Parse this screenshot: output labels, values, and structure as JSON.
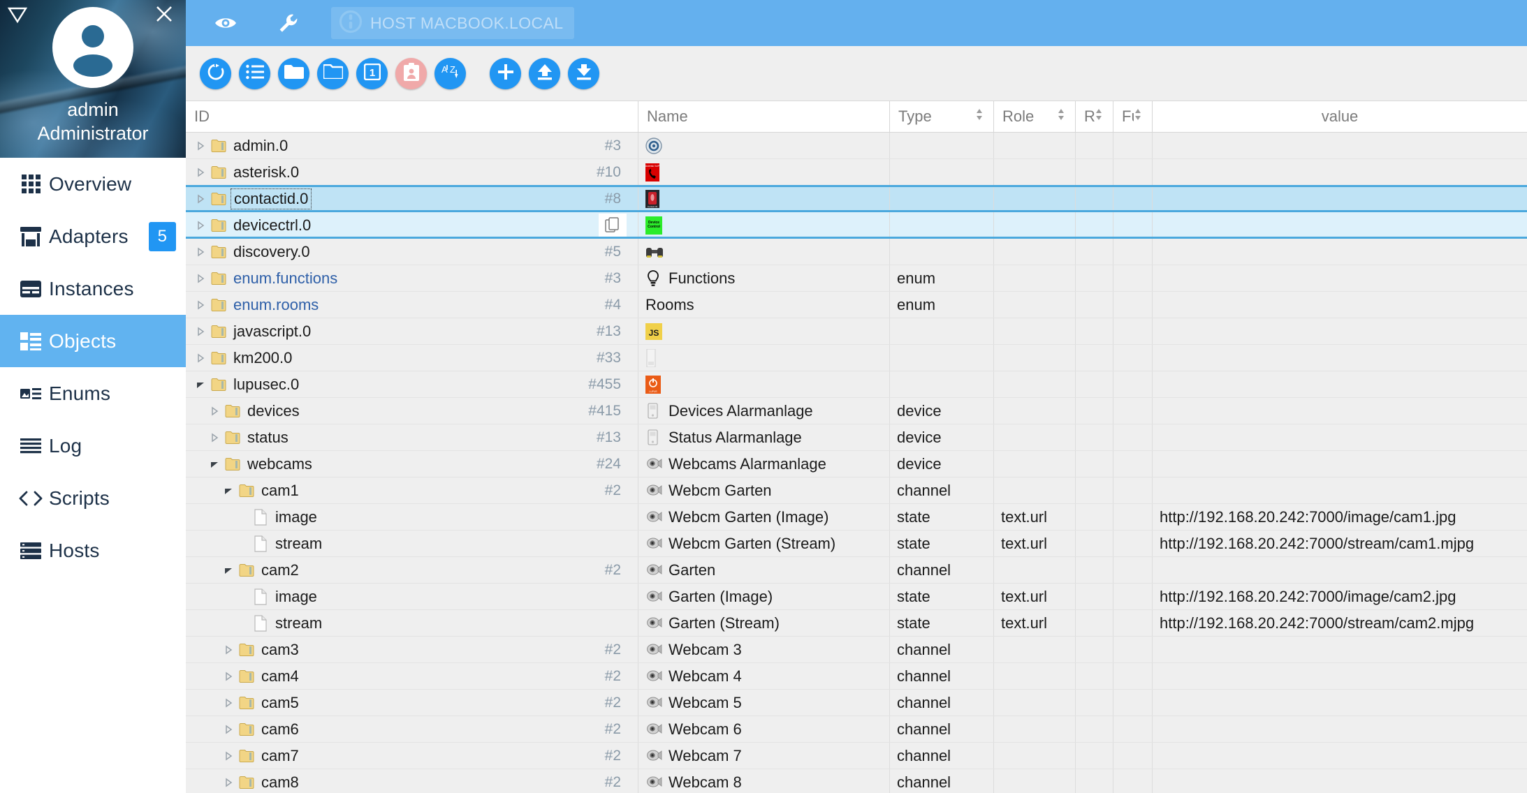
{
  "sidebar": {
    "caret_icon": "triangle-down-icon",
    "close_icon": "close-icon",
    "avatar_icon": "user-avatar-icon",
    "user_name": "admin",
    "user_role": "Administrator",
    "items": [
      {
        "label": "Overview",
        "icon": "grid-icon",
        "active": false,
        "badge": ""
      },
      {
        "label": "Adapters",
        "icon": "store-icon",
        "active": false,
        "badge": "5"
      },
      {
        "label": "Instances",
        "icon": "instances-icon",
        "active": false,
        "badge": ""
      },
      {
        "label": "Objects",
        "icon": "list-box-icon",
        "active": true,
        "badge": ""
      },
      {
        "label": "Enums",
        "icon": "enums-icon",
        "active": false,
        "badge": ""
      },
      {
        "label": "Log",
        "icon": "lines-icon",
        "active": false,
        "badge": ""
      },
      {
        "label": "Scripts",
        "icon": "code-icon",
        "active": false,
        "badge": ""
      },
      {
        "label": "Hosts",
        "icon": "server-icon",
        "active": false,
        "badge": ""
      }
    ]
  },
  "topbar": {
    "eye_icon": "eye-icon",
    "wrench_icon": "wrench-icon",
    "host_icon": "power-info-icon",
    "host_label": "HOST MACBOOK.LOCAL",
    "accent_color": "#64b0ee"
  },
  "toolbar": {
    "buttons": [
      {
        "name": "refresh-button",
        "icon": "refresh-icon",
        "color": "#2196f3"
      },
      {
        "name": "expand-list-button",
        "icon": "list-icon",
        "color": "#2196f3"
      },
      {
        "name": "expand-all-button",
        "icon": "folder-open-icon",
        "color": "#2196f3"
      },
      {
        "name": "collapse-all-button",
        "icon": "folder-icon",
        "color": "#2196f3"
      },
      {
        "name": "depth-one-button",
        "icon": "number-one-icon",
        "color": "#2196f3"
      },
      {
        "name": "user-filter-button",
        "icon": "id-card-icon",
        "color": "#f0a9a9"
      },
      {
        "name": "sort-az-button",
        "icon": "sort-az-icon",
        "color": "#2196f3"
      },
      {
        "name": "add-object-button",
        "icon": "plus-icon",
        "color": "#2196f3"
      },
      {
        "name": "import-button",
        "icon": "upload-icon",
        "color": "#2196f3"
      },
      {
        "name": "export-button",
        "icon": "download-icon",
        "color": "#2196f3"
      }
    ]
  },
  "table": {
    "columns": [
      {
        "key": "id",
        "label": "ID",
        "sortable": false
      },
      {
        "key": "name",
        "label": "Name",
        "sortable": false
      },
      {
        "key": "type",
        "label": "Type",
        "sortable": true
      },
      {
        "key": "role",
        "label": "Role",
        "sortable": true
      },
      {
        "key": "room",
        "label": "Roc",
        "sortable": true
      },
      {
        "key": "func",
        "label": "Fur",
        "sortable": true
      },
      {
        "key": "value",
        "label": "value",
        "sortable": false
      }
    ],
    "rows": [
      {
        "indent": 0,
        "twisty": "collapsed",
        "node": "folder",
        "id": "admin.0",
        "count": "#3",
        "name": "",
        "name_icon": "admin-gear-icon",
        "type": "",
        "role": "",
        "room": "",
        "func": "",
        "value": "",
        "state": "normal",
        "id_style": "plain",
        "copy": false
      },
      {
        "indent": 0,
        "twisty": "collapsed",
        "node": "folder",
        "id": "asterisk.0",
        "count": "#10",
        "name": "",
        "name_icon": "asterisk-icon",
        "type": "",
        "role": "",
        "room": "",
        "func": "",
        "value": "",
        "state": "normal",
        "id_style": "plain",
        "copy": false
      },
      {
        "indent": 0,
        "twisty": "collapsed",
        "node": "folder",
        "id": "contactid.0",
        "count": "#8",
        "name": "",
        "name_icon": "contactid-icon",
        "type": "",
        "role": "",
        "room": "",
        "func": "",
        "value": "",
        "state": "selected-primary",
        "id_style": "boxed",
        "copy": false
      },
      {
        "indent": 0,
        "twisty": "collapsed",
        "node": "folder",
        "id": "devicectrl.0",
        "count": "",
        "name": "",
        "name_icon": "devicectrl-icon",
        "type": "",
        "role": "",
        "room": "",
        "func": "",
        "value": "",
        "state": "selected-secondary",
        "id_style": "plain",
        "copy": true
      },
      {
        "indent": 0,
        "twisty": "collapsed",
        "node": "folder",
        "id": "discovery.0",
        "count": "#5",
        "name": "",
        "name_icon": "binoculars-icon",
        "type": "",
        "role": "",
        "room": "",
        "func": "",
        "value": "",
        "state": "normal",
        "id_style": "plain",
        "copy": false
      },
      {
        "indent": 0,
        "twisty": "collapsed",
        "node": "folder",
        "id": "enum.functions",
        "count": "#3",
        "name": "Functions",
        "name_icon": "bulb-icon",
        "type": "enum",
        "role": "",
        "room": "",
        "func": "",
        "value": "",
        "state": "normal",
        "id_style": "link",
        "copy": false
      },
      {
        "indent": 0,
        "twisty": "collapsed",
        "node": "folder",
        "id": "enum.rooms",
        "count": "#4",
        "name": "Rooms",
        "name_icon": "",
        "type": "enum",
        "role": "",
        "room": "",
        "func": "",
        "value": "",
        "state": "normal",
        "id_style": "link",
        "copy": false
      },
      {
        "indent": 0,
        "twisty": "collapsed",
        "node": "folder",
        "id": "javascript.0",
        "count": "#13",
        "name": "",
        "name_icon": "js-icon",
        "type": "",
        "role": "",
        "room": "",
        "func": "",
        "value": "",
        "state": "normal",
        "id_style": "plain",
        "copy": false
      },
      {
        "indent": 0,
        "twisty": "collapsed",
        "node": "folder",
        "id": "km200.0",
        "count": "#33",
        "name": "",
        "name_icon": "km200-icon",
        "type": "",
        "role": "",
        "room": "",
        "func": "",
        "value": "",
        "state": "normal",
        "id_style": "plain",
        "copy": false
      },
      {
        "indent": 0,
        "twisty": "expanded",
        "node": "folder",
        "id": "lupusec.0",
        "count": "#455",
        "name": "",
        "name_icon": "lupusec-icon",
        "type": "",
        "role": "",
        "room": "",
        "func": "",
        "value": "",
        "state": "normal",
        "id_style": "plain",
        "copy": false
      },
      {
        "indent": 1,
        "twisty": "collapsed",
        "node": "folder",
        "id": "devices",
        "count": "#415",
        "name": "Devices Alarmanlage",
        "name_icon": "device-icon",
        "type": "device",
        "role": "",
        "room": "",
        "func": "",
        "value": "",
        "state": "normal",
        "id_style": "plain",
        "copy": false
      },
      {
        "indent": 1,
        "twisty": "collapsed",
        "node": "folder",
        "id": "status",
        "count": "#13",
        "name": "Status Alarmanlage",
        "name_icon": "device-icon",
        "type": "device",
        "role": "",
        "room": "",
        "func": "",
        "value": "",
        "state": "normal",
        "id_style": "plain",
        "copy": false
      },
      {
        "indent": 1,
        "twisty": "expanded",
        "node": "folder",
        "id": "webcams",
        "count": "#24",
        "name": "Webcams Alarmanlage",
        "name_icon": "webcam-icon",
        "type": "device",
        "role": "",
        "room": "",
        "func": "",
        "value": "",
        "state": "normal",
        "id_style": "plain",
        "copy": false
      },
      {
        "indent": 2,
        "twisty": "expanded",
        "node": "folder",
        "id": "cam1",
        "count": "#2",
        "name": "Webcm Garten",
        "name_icon": "webcam-icon",
        "type": "channel",
        "role": "",
        "room": "",
        "func": "",
        "value": "",
        "state": "normal",
        "id_style": "plain",
        "copy": false
      },
      {
        "indent": 3,
        "twisty": "none",
        "node": "file",
        "id": "image",
        "count": "",
        "name": "Webcm Garten (Image)",
        "name_icon": "webcam-icon",
        "type": "state",
        "role": "text.url",
        "room": "",
        "func": "",
        "value": "http://192.168.20.242:7000/image/cam1.jpg",
        "state": "normal",
        "id_style": "plain",
        "copy": false
      },
      {
        "indent": 3,
        "twisty": "none",
        "node": "file",
        "id": "stream",
        "count": "",
        "name": "Webcm Garten (Stream)",
        "name_icon": "webcam-icon",
        "type": "state",
        "role": "text.url",
        "room": "",
        "func": "",
        "value": "http://192.168.20.242:7000/stream/cam1.mjpg",
        "state": "normal",
        "id_style": "plain",
        "copy": false
      },
      {
        "indent": 2,
        "twisty": "expanded",
        "node": "folder",
        "id": "cam2",
        "count": "#2",
        "name": "Garten",
        "name_icon": "webcam-icon",
        "type": "channel",
        "role": "",
        "room": "",
        "func": "",
        "value": "",
        "state": "normal",
        "id_style": "plain",
        "copy": false
      },
      {
        "indent": 3,
        "twisty": "none",
        "node": "file",
        "id": "image",
        "count": "",
        "name": "Garten (Image)",
        "name_icon": "webcam-icon",
        "type": "state",
        "role": "text.url",
        "room": "",
        "func": "",
        "value": "http://192.168.20.242:7000/image/cam2.jpg",
        "state": "normal",
        "id_style": "plain",
        "copy": false
      },
      {
        "indent": 3,
        "twisty": "none",
        "node": "file",
        "id": "stream",
        "count": "",
        "name": "Garten (Stream)",
        "name_icon": "webcam-icon",
        "type": "state",
        "role": "text.url",
        "room": "",
        "func": "",
        "value": "http://192.168.20.242:7000/stream/cam2.mjpg",
        "state": "normal",
        "id_style": "plain",
        "copy": false
      },
      {
        "indent": 2,
        "twisty": "collapsed",
        "node": "folder",
        "id": "cam3",
        "count": "#2",
        "name": "Webcam 3",
        "name_icon": "webcam-icon",
        "type": "channel",
        "role": "",
        "room": "",
        "func": "",
        "value": "",
        "state": "normal",
        "id_style": "plain",
        "copy": false
      },
      {
        "indent": 2,
        "twisty": "collapsed",
        "node": "folder",
        "id": "cam4",
        "count": "#2",
        "name": "Webcam 4",
        "name_icon": "webcam-icon",
        "type": "channel",
        "role": "",
        "room": "",
        "func": "",
        "value": "",
        "state": "normal",
        "id_style": "plain",
        "copy": false
      },
      {
        "indent": 2,
        "twisty": "collapsed",
        "node": "folder",
        "id": "cam5",
        "count": "#2",
        "name": "Webcam 5",
        "name_icon": "webcam-icon",
        "type": "channel",
        "role": "",
        "room": "",
        "func": "",
        "value": "",
        "state": "normal",
        "id_style": "plain",
        "copy": false
      },
      {
        "indent": 2,
        "twisty": "collapsed",
        "node": "folder",
        "id": "cam6",
        "count": "#2",
        "name": "Webcam 6",
        "name_icon": "webcam-icon",
        "type": "channel",
        "role": "",
        "room": "",
        "func": "",
        "value": "",
        "state": "normal",
        "id_style": "plain",
        "copy": false
      },
      {
        "indent": 2,
        "twisty": "collapsed",
        "node": "folder",
        "id": "cam7",
        "count": "#2",
        "name": "Webcam 7",
        "name_icon": "webcam-icon",
        "type": "channel",
        "role": "",
        "room": "",
        "func": "",
        "value": "",
        "state": "normal",
        "id_style": "plain",
        "copy": false
      },
      {
        "indent": 2,
        "twisty": "collapsed",
        "node": "folder",
        "id": "cam8",
        "count": "#2",
        "name": "Webcam 8",
        "name_icon": "webcam-icon",
        "type": "channel",
        "role": "",
        "room": "",
        "func": "",
        "value": "",
        "state": "normal",
        "id_style": "plain",
        "copy": false
      }
    ]
  }
}
